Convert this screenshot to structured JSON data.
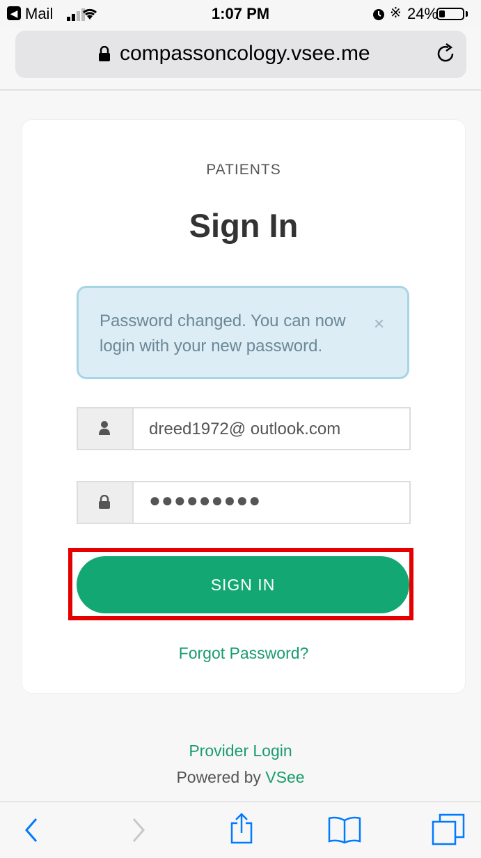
{
  "status_bar": {
    "back_app": "Mail",
    "time": "1:07 PM",
    "battery_percent": "24%",
    "battery_level": 0.24,
    "icons": [
      "back-to-app-icon",
      "signal-icon",
      "wifi-icon",
      "alarm-icon",
      "bluetooth-icon",
      "battery-icon"
    ]
  },
  "address_bar": {
    "url": "compassoncology.vsee.me",
    "icons": [
      "lock-icon",
      "reload-icon"
    ]
  },
  "login": {
    "eyebrow": "PATIENTS",
    "title": "Sign In",
    "alert": "Password changed. You can now login with your new password.",
    "alert_close": "×",
    "email_value": "dreed1972@ outlook.com",
    "password_value": "●●●●●●●●●",
    "submit_label": "SIGN IN",
    "forgot_label": "Forgot Password?",
    "colors": {
      "primary": "#13a873",
      "alert_bg": "#dcedf5",
      "highlight": "#e40000"
    }
  },
  "footer": {
    "provider_login": "Provider Login",
    "powered_by": "Powered by",
    "brand": "VSee"
  },
  "toolbar": {
    "icons": [
      "back-icon",
      "forward-icon",
      "share-icon",
      "bookmarks-icon",
      "tabs-icon"
    ]
  }
}
